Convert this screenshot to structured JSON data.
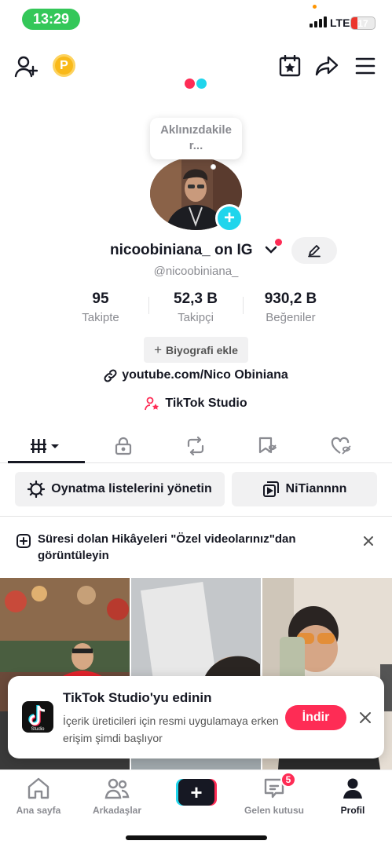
{
  "status_bar": {
    "time": "13:29",
    "network": "LTE",
    "battery": "17",
    "battery_color": "#ff3b30",
    "time_pill_color": "#34c759"
  },
  "header": {
    "add_friend_icon": "person-add-icon",
    "coin_label": "P",
    "calendar_icon": "calendar-star-icon",
    "share_icon": "share-icon",
    "menu_icon": "hamburger-icon"
  },
  "profile": {
    "tooltip": "Aklınızdakiler...",
    "username": "nicoobiniana_ on IG",
    "handle": "@nicoobiniana_",
    "stats": [
      {
        "value": "95",
        "label": "Takipte"
      },
      {
        "value": "52,3 B",
        "label": "Takipçi"
      },
      {
        "value": "930,2 B",
        "label": "Beğeniler"
      }
    ],
    "bio_button": "Biyografi ekle",
    "link": "youtube.com/Nico Obiniana",
    "studio_link": "TikTok Studio"
  },
  "tabs": [
    {
      "icon": "videos-grid-icon",
      "active": true
    },
    {
      "icon": "lock-icon",
      "active": false
    },
    {
      "icon": "repost-icon",
      "active": false
    },
    {
      "icon": "bookmark-hidden-icon",
      "active": false
    },
    {
      "icon": "liked-hidden-icon",
      "active": false
    }
  ],
  "actions": {
    "playlists": "Oynatma listelerini yönetin",
    "playlist_name": "NiTiannnn"
  },
  "story_notice": {
    "text": "Süresi dolan Hikâyeleri \"Özel videolarınız\"dan görüntüleyin"
  },
  "promo": {
    "logo_text": "Studio",
    "title": "TikTok Studio'yu edinin",
    "description": "İçerik üreticileri için resmi uygulamaya erken erişim şimdi başlıyor",
    "button": "İndir"
  },
  "bottom_nav": {
    "items": [
      {
        "label": "Ana sayfa",
        "icon": "home-icon"
      },
      {
        "label": "Arkadaşlar",
        "icon": "friends-icon"
      },
      {
        "label": "",
        "icon": "create-plus-icon"
      },
      {
        "label": "Gelen kutusu",
        "icon": "inbox-icon",
        "badge": "5"
      },
      {
        "label": "Profil",
        "icon": "profile-icon",
        "active": true
      }
    ]
  },
  "colors": {
    "accent": "#fe2c55",
    "cyan": "#20d5ec",
    "text": "#161823",
    "muted": "#8a8b91"
  }
}
